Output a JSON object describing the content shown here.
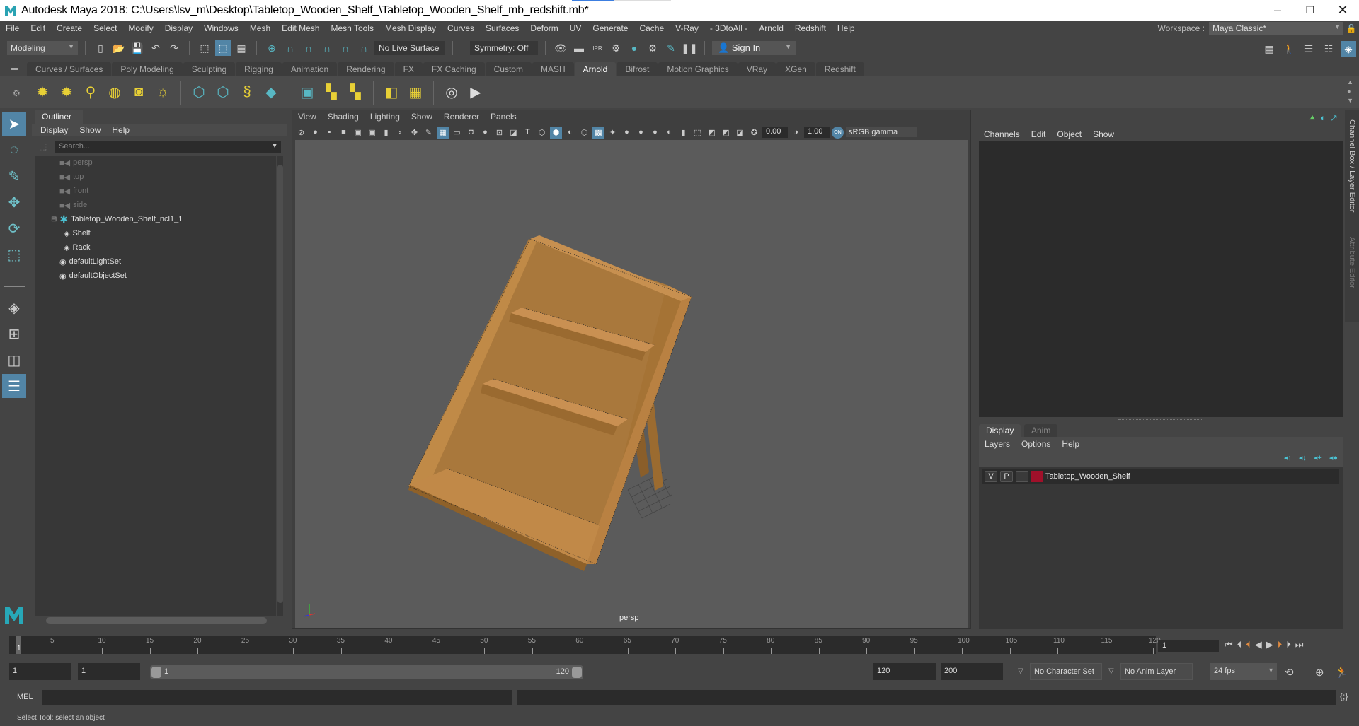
{
  "window": {
    "title": "Autodesk Maya 2018: C:\\Users\\lsv_m\\Desktop\\Tabletop_Wooden_Shelf_\\Tabletop_Wooden_Shelf_mb_redshift.mb*",
    "minimize": "–",
    "restore": "❐",
    "close": "✕"
  },
  "menubar": {
    "items": [
      "File",
      "Edit",
      "Create",
      "Select",
      "Modify",
      "Display",
      "Windows",
      "Mesh",
      "Edit Mesh",
      "Mesh Tools",
      "Mesh Display",
      "Curves",
      "Surfaces",
      "Deform",
      "UV",
      "Generate",
      "Cache",
      "V-Ray",
      "- 3DtoAll -",
      "Arnold",
      "Redshift",
      "Help"
    ],
    "workspace_label": "Workspace :",
    "workspace_value": "Maya Classic*"
  },
  "statusline": {
    "mode": "Modeling",
    "live_surface": "No Live Surface",
    "symmetry": "Symmetry: Off",
    "sign_in": "Sign In"
  },
  "shelf": {
    "tabs": [
      "Curves / Surfaces",
      "Poly Modeling",
      "Sculpting",
      "Rigging",
      "Animation",
      "Rendering",
      "FX",
      "FX Caching",
      "Custom",
      "MASH",
      "Arnold",
      "Bifrost",
      "Motion Graphics",
      "VRay",
      "XGen",
      "Redshift"
    ],
    "active_tab": "Arnold"
  },
  "outliner": {
    "title": "Outliner",
    "menu": [
      "Display",
      "Show",
      "Help"
    ],
    "search_placeholder": "Search...",
    "items": [
      {
        "label": "persp",
        "icon": "camera-icon",
        "dim": true
      },
      {
        "label": "top",
        "icon": "camera-icon",
        "dim": true
      },
      {
        "label": "front",
        "icon": "camera-icon",
        "dim": true
      },
      {
        "label": "side",
        "icon": "camera-icon",
        "dim": true
      },
      {
        "label": "Tabletop_Wooden_Shelf_ncl1_1",
        "icon": "group-icon",
        "dim": false,
        "expanded": true
      },
      {
        "label": "Shelf",
        "icon": "mesh-icon",
        "dim": false,
        "child": true
      },
      {
        "label": "Rack",
        "icon": "mesh-icon",
        "dim": false,
        "child": true
      },
      {
        "label": "defaultLightSet",
        "icon": "set-icon",
        "dim": false
      },
      {
        "label": "defaultObjectSet",
        "icon": "set-icon",
        "dim": false
      }
    ]
  },
  "viewport": {
    "menu": [
      "View",
      "Shading",
      "Lighting",
      "Show",
      "Renderer",
      "Panels"
    ],
    "exposure": "0.00",
    "gamma": "1.00",
    "color_space": "sRGB gamma",
    "camera_label": "persp"
  },
  "channelbox": {
    "menu": [
      "Channels",
      "Edit",
      "Object",
      "Show"
    ],
    "side_tab_1": "Channel Box / Layer Editor",
    "side_tab_2": "Attribute Editor"
  },
  "layer_editor": {
    "tabs": [
      "Display",
      "Anim"
    ],
    "active_tab": "Display",
    "menu": [
      "Layers",
      "Options",
      "Help"
    ],
    "layers": [
      {
        "visible": "V",
        "playback": "P",
        "name": "Tabletop_Wooden_Shelf",
        "color": "#a0102a"
      }
    ]
  },
  "timeline": {
    "ticks": [
      5,
      10,
      15,
      20,
      25,
      30,
      35,
      40,
      45,
      50,
      55,
      60,
      65,
      70,
      75,
      80,
      85,
      90,
      95,
      100,
      105,
      110,
      115,
      120
    ],
    "current_frame": "1",
    "current_frame_field": "1"
  },
  "range": {
    "start": "1",
    "anim_start": "1",
    "slider_start": "1",
    "slider_end": "120",
    "end": "120",
    "anim_end": "200",
    "character_set": "No Character Set",
    "anim_layer": "No Anim Layer",
    "fps": "24 fps"
  },
  "commandline": {
    "label": "MEL"
  },
  "helpline": {
    "text": "Select Tool: select an object"
  },
  "colors": {
    "accent": "#5285a6",
    "teal": "#58b8c4",
    "wood": "#b07c3c"
  }
}
